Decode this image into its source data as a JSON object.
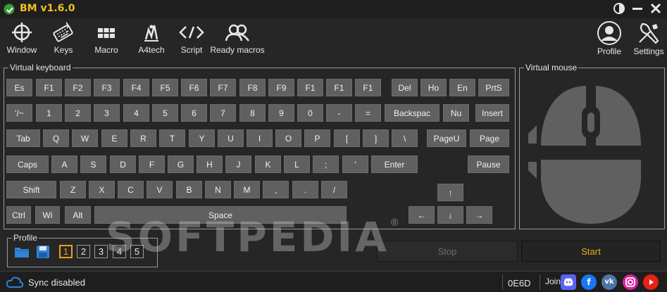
{
  "window": {
    "title": "BM v1.6.0"
  },
  "toolbar": {
    "items": [
      {
        "label": "Window",
        "icon": "crosshair-icon"
      },
      {
        "label": "Keys",
        "icon": "keyboard-icon"
      },
      {
        "label": "Macro",
        "icon": "macro-grid-icon"
      },
      {
        "label": "A4tech",
        "icon": "a4tech-logo-icon"
      },
      {
        "label": "Script",
        "icon": "code-brackets-icon"
      },
      {
        "label": "Ready macros",
        "icon": "users-icon"
      }
    ],
    "right_items": [
      {
        "label": "Profile",
        "icon": "user-avatar-icon"
      },
      {
        "label": "Settings",
        "icon": "wrench-screwdriver-icon"
      }
    ]
  },
  "keyboard": {
    "title": "Virtual keyboard",
    "rows": [
      [
        "Es",
        "F1",
        "F2",
        "F3",
        "F4",
        "F5",
        "F6",
        "F7",
        "F8",
        "F9",
        "F1",
        "F1",
        "F1",
        "Del",
        "Ho",
        "En",
        "PrtS"
      ],
      [
        "'/~",
        "1",
        "2",
        "3",
        "4",
        "5",
        "6",
        "7",
        "8",
        "9",
        "0",
        "-",
        "=",
        "Backspac",
        "Nu",
        "Insert"
      ],
      [
        "Tab",
        "Q",
        "W",
        "E",
        "R",
        "T",
        "Y",
        "U",
        "I",
        "O",
        "P",
        "[",
        "]",
        "\\",
        "PageU",
        "Page"
      ],
      [
        "Caps",
        "A",
        "S",
        "D",
        "F",
        "G",
        "H",
        "J",
        "K",
        "L",
        ";",
        "'",
        "Enter",
        "Pause"
      ],
      [
        "Shift",
        "Z",
        "X",
        "C",
        "V",
        "B",
        "N",
        "M",
        ",",
        ".",
        "/",
        "↑"
      ],
      [
        "Ctrl",
        "Wi",
        "Alt",
        "Space",
        "←",
        "↓",
        "→"
      ]
    ]
  },
  "mouse": {
    "title": "Virtual mouse"
  },
  "profile": {
    "title": "Profile",
    "slots": [
      "1",
      "2",
      "3",
      "4",
      "5"
    ],
    "active_slot": "1"
  },
  "actions": {
    "stop_label": "Stop",
    "start_label": "Start"
  },
  "watermark": {
    "text": "SOFTPEDIA",
    "mark": "®"
  },
  "status": {
    "sync_text": "Sync disabled",
    "hex_value": "0E6D",
    "join_label": "Join"
  },
  "colors": {
    "accent": "#e8a020",
    "title": "#f0c020",
    "key_bg": "#606060",
    "background": "#262626"
  }
}
